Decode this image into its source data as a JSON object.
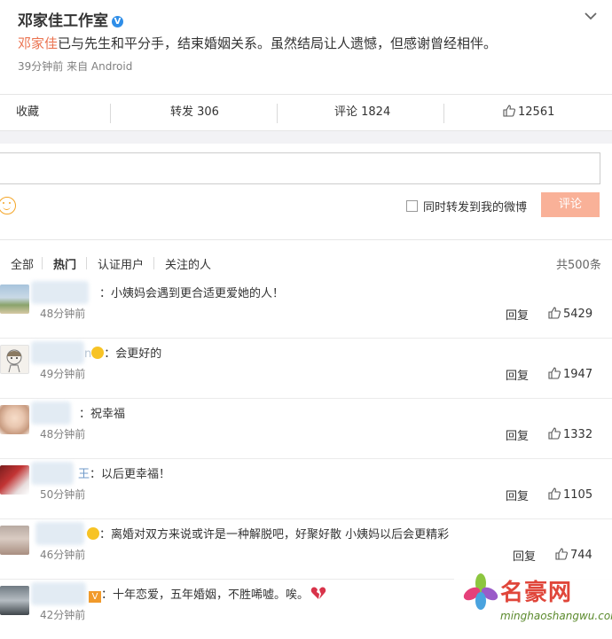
{
  "post": {
    "author": "邓家佳工作室",
    "mention": "邓家佳",
    "text": "已与先生和平分手，结束婚姻关系。虽然结局让人遗憾，但感谢曾经相伴。",
    "time": "39分钟前",
    "source": "来自 Android"
  },
  "toolbar": {
    "favorite": "收藏",
    "repost": "转发 306",
    "comment": "评论 1824",
    "like": "12561"
  },
  "composer": {
    "value": "",
    "repost_label": "同时转发到我的微博",
    "submit": "评论"
  },
  "filters": {
    "all": "全部",
    "hot": "热门",
    "verified": "认证用户",
    "following": "关注的人",
    "total": "共500条"
  },
  "comments": [
    {
      "name_suffix": "",
      "text": "：小姨妈会遇到更合适更爱她的人！",
      "time": "48分钟前",
      "reply": "回复",
      "likes": "5429"
    },
    {
      "name_suffix": "n",
      "text": "：会更好的",
      "time": "49分钟前",
      "reply": "回复",
      "likes": "1947"
    },
    {
      "name_suffix": "",
      "text": "：祝幸福",
      "time": "48分钟前",
      "reply": "回复",
      "likes": "1332"
    },
    {
      "name_suffix": "王",
      "text": "：以后更幸福！",
      "time": "50分钟前",
      "reply": "回复",
      "likes": "1105"
    },
    {
      "name_suffix": "",
      "text": "：离婚对双方来说或许是一种解脱吧，好聚好散 小姨妈以后会更精彩",
      "time": "46分钟前",
      "reply": "回复",
      "likes": "744"
    },
    {
      "name_suffix": "",
      "text": "：十年恋爱，五年婚姻，不胜唏嘘。唉。",
      "time": "42分钟前",
      "reply": "回复",
      "likes": ""
    }
  ],
  "watermark": {
    "title": "名豪网",
    "url": "minghaoshangwu.com"
  },
  "colors": {
    "accent": "#eb7350",
    "button": "#f9b198",
    "verified": "#2f8ee8"
  }
}
